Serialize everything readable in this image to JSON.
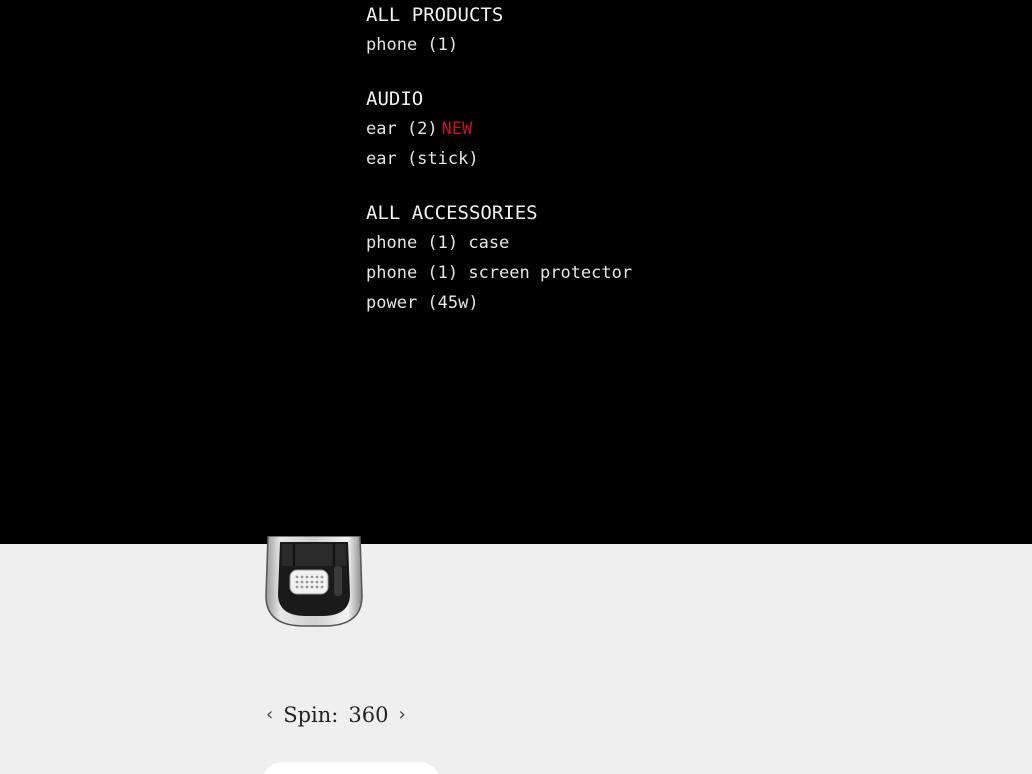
{
  "menu": {
    "groups": [
      {
        "heading": "ALL PRODUCTS",
        "items": [
          {
            "label": "phone (1)"
          }
        ]
      },
      {
        "heading": "AUDIO",
        "items": [
          {
            "label": "ear (2)",
            "badge": "NEW"
          },
          {
            "label": "ear (stick)"
          }
        ]
      },
      {
        "heading": "ALL ACCESSORIES",
        "items": [
          {
            "label": "phone (1) case"
          },
          {
            "label": "phone (1) screen protector"
          },
          {
            "label": "power (45w)"
          }
        ]
      }
    ],
    "badge_color": "#c8102e",
    "background": "#000000"
  },
  "product": {
    "image_icon": "earbud-case-icon"
  },
  "spin": {
    "prev_icon": "‹",
    "label": "Spin:",
    "value": "360",
    "next_icon": "›"
  }
}
